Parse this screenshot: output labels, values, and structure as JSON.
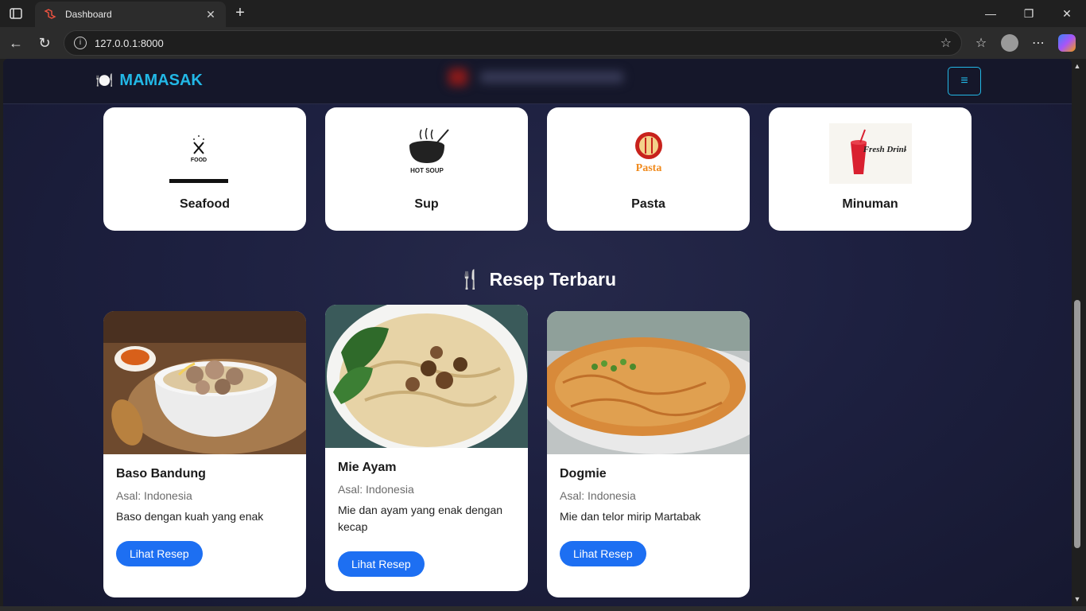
{
  "browser": {
    "tab_title": "Dashboard",
    "url": "127.0.0.1:8000",
    "new_tab_symbol": "+"
  },
  "site": {
    "brand_name": "MAMASAK",
    "brand_icon": "🍽️",
    "menu_icon": "≡"
  },
  "categories": [
    {
      "label": "Seafood",
      "image": "food-logo-icon"
    },
    {
      "label": "Sup",
      "image": "hot-soup-logo-icon",
      "logo_text": "HOT SOUP"
    },
    {
      "label": "Pasta",
      "image": "pasta-logo-icon",
      "logo_text": "Pasta"
    },
    {
      "label": "Minuman",
      "image": "fresh-drink-logo-icon",
      "logo_text": "Fresh Drink"
    }
  ],
  "latest": {
    "title": "Resep Terbaru",
    "icon": "🍴"
  },
  "recipes": [
    {
      "name": "Baso Bandung",
      "origin": "Asal: Indonesia",
      "description": "Baso dengan kuah yang enak",
      "button": "Lihat Resep"
    },
    {
      "name": "Mie Ayam",
      "origin": "Asal: Indonesia",
      "description": "Mie dan ayam yang enak dengan kecap",
      "button": "Lihat Resep"
    },
    {
      "name": "Dogmie",
      "origin": "Asal: Indonesia",
      "description": "Mie dan telor mirip Martabak",
      "button": "Lihat Resep"
    }
  ],
  "colors": {
    "brand": "#22b8e6",
    "button": "#1d6ff2",
    "background": "#1d2040"
  }
}
